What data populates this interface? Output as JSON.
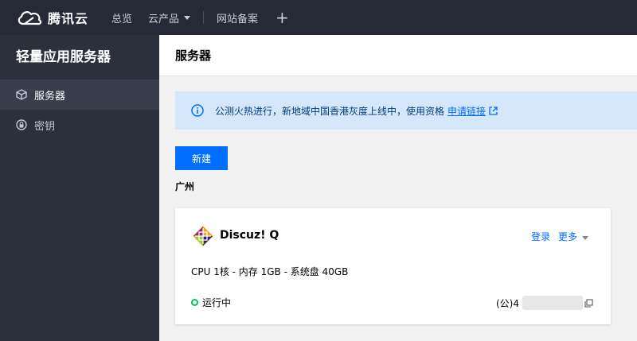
{
  "brand": {
    "name": "腾讯云"
  },
  "topnav": {
    "items": [
      {
        "label": "总览"
      },
      {
        "label": "云产品"
      },
      {
        "label": "网站备案"
      }
    ],
    "plus_label": "+"
  },
  "sidebar": {
    "title": "轻量应用服务器",
    "items": [
      {
        "label": "服务器",
        "icon": "cube-icon",
        "active": true
      },
      {
        "label": "密钥",
        "icon": "lock-icon",
        "active": false
      }
    ]
  },
  "main": {
    "title": "服务器",
    "notice": {
      "text": "公测火热进行，新地域中国香港灰度上线中，使用资格",
      "link": "申请链接"
    },
    "new_button": "新建",
    "region": "广州",
    "instance": {
      "name": "Discuz! Q",
      "login": "登录",
      "more": "更多",
      "spec": "CPU 1核 - 内存 1GB - 系统盘 40GB",
      "status": "运行中",
      "ip_prefix": "(公)4"
    }
  },
  "colors": {
    "topbar": "#262a36",
    "sidebar": "#2b303b",
    "accent": "#006eff",
    "status_ok": "#0abf5b",
    "notice_bg": "#d5e7fa"
  }
}
